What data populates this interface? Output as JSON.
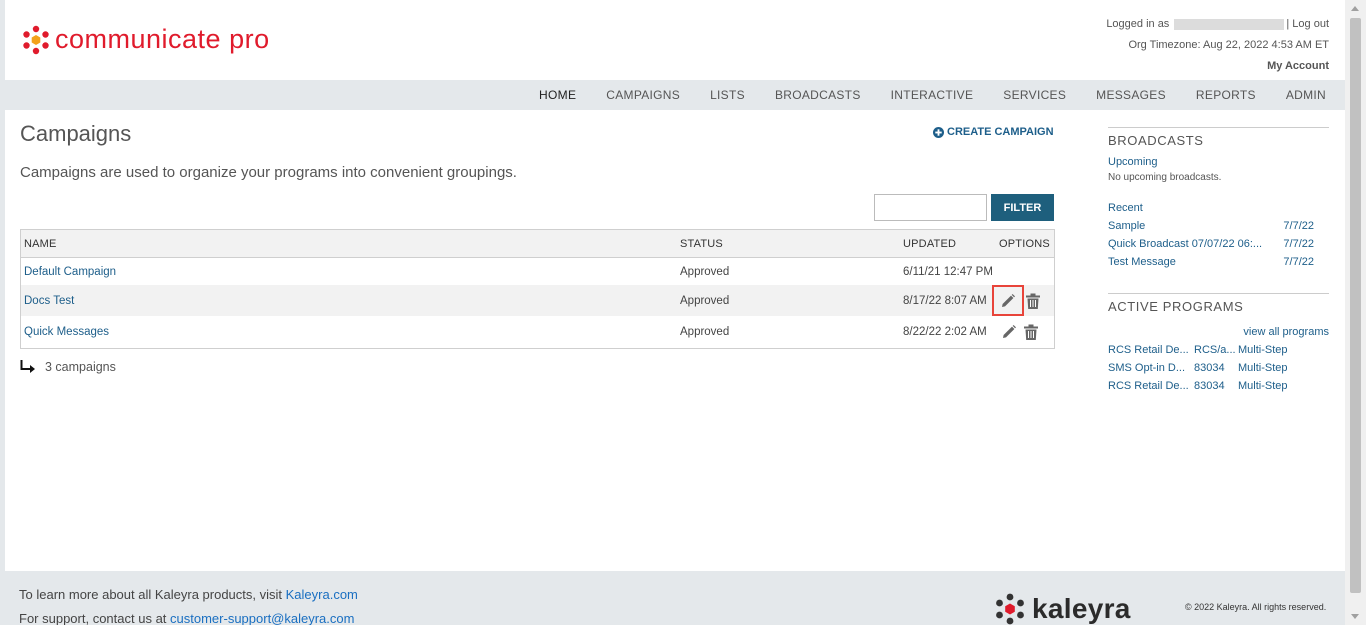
{
  "brand": {
    "name": "communicate pro",
    "accent": "#e01b2c"
  },
  "user": {
    "logged_in_prefix": "Logged in as",
    "separator": "|",
    "logout": "Log out",
    "timezone": "Org Timezone: Aug 22, 2022 4:53 AM ET",
    "my_account": "My Account"
  },
  "nav": [
    "HOME",
    "CAMPAIGNS",
    "LISTS",
    "BROADCASTS",
    "INTERACTIVE",
    "SERVICES",
    "MESSAGES",
    "REPORTS",
    "ADMIN"
  ],
  "main": {
    "title": "Campaigns",
    "create_label": "CREATE CAMPAIGN",
    "description": "Campaigns are used to organize your programs into convenient groupings.",
    "filter_value": "",
    "filter_button": "FILTER",
    "columns": {
      "name": "NAME",
      "status": "STATUS",
      "updated": "UPDATED",
      "options": "OPTIONS"
    },
    "rows": [
      {
        "name": "Default Campaign",
        "status": "Approved",
        "updated": "6/11/21 12:47 PM"
      },
      {
        "name": "Docs Test",
        "status": "Approved",
        "updated": "8/17/22 8:07 AM"
      },
      {
        "name": "Quick Messages",
        "status": "Approved",
        "updated": "8/22/22 2:02 AM"
      }
    ],
    "count": "3 campaigns"
  },
  "sidebar": {
    "broadcasts": {
      "title": "BROADCASTS",
      "upcoming_label": "Upcoming",
      "upcoming_note": "No upcoming broadcasts.",
      "recent_label": "Recent",
      "recent": [
        {
          "name": "Sample",
          "date": "7/7/22"
        },
        {
          "name": "Quick Broadcast 07/07/22 06:...",
          "date": "7/7/22"
        },
        {
          "name": "Test Message",
          "date": "7/7/22"
        }
      ]
    },
    "programs": {
      "title": "ACTIVE PROGRAMS",
      "view_all": "view all programs",
      "items": [
        {
          "name": "RCS Retail De...",
          "code": "RCS/a...",
          "type": "Multi-Step"
        },
        {
          "name": "SMS Opt-in D...",
          "code": "83034",
          "type": "Multi-Step"
        },
        {
          "name": "RCS Retail De...",
          "code": "83034",
          "type": "Multi-Step"
        }
      ]
    }
  },
  "footer": {
    "learn_prefix": "To learn more about all Kaleyra products, visit",
    "learn_link": "Kaleyra.com",
    "support_prefix": "For support, contact us at",
    "support_link": "customer-support@kaleyra.com",
    "logo_text": "kaleyra",
    "copyright": "© 2022 Kaleyra. All rights reserved."
  }
}
